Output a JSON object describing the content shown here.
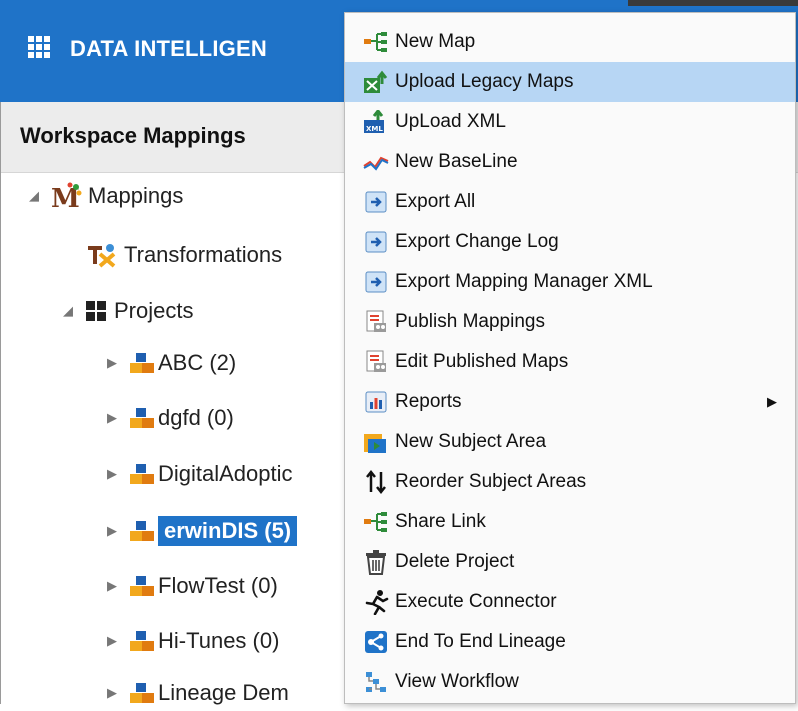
{
  "app": {
    "title": "DATA INTELLIGEN",
    "colors": {
      "header": "#1f73c8",
      "menu_highlight": "#b7d6f4"
    }
  },
  "workspace": {
    "title": "Workspace Mappings"
  },
  "tree": {
    "mappings": {
      "label": "Mappings",
      "icon": "mappings-icon"
    },
    "transformations": {
      "label": "Transformations",
      "icon": "transformations-icon"
    },
    "projects": {
      "label": "Projects",
      "icon": "projects-icon"
    },
    "items": [
      {
        "label": "ABC (2)"
      },
      {
        "label": "dgfd (0)"
      },
      {
        "label": "DigitalAdoptic"
      },
      {
        "label": "erwinDIS (5)",
        "selected": true
      },
      {
        "label": "FlowTest (0)"
      },
      {
        "label": "Hi-Tunes (0)"
      },
      {
        "label": "Lineage Dem"
      }
    ]
  },
  "menu": {
    "items": [
      {
        "label": "New Map",
        "icon": "new-map-icon"
      },
      {
        "label": "Upload Legacy Maps",
        "icon": "upload-legacy-icon",
        "highlighted": true
      },
      {
        "label": "UpLoad XML",
        "icon": "upload-xml-icon"
      },
      {
        "label": "New BaseLine",
        "icon": "baseline-icon"
      },
      {
        "label": "Export All",
        "icon": "export-icon"
      },
      {
        "label": "Export Change Log",
        "icon": "export-icon"
      },
      {
        "label": "Export Mapping Manager XML",
        "icon": "export-icon"
      },
      {
        "label": "Publish Mappings",
        "icon": "publish-icon"
      },
      {
        "label": "Edit Published Maps",
        "icon": "publish-icon"
      },
      {
        "label": "Reports",
        "icon": "reports-icon",
        "submenu": true
      },
      {
        "label": "New Subject Area",
        "icon": "subject-area-icon"
      },
      {
        "label": "Reorder Subject Areas",
        "icon": "reorder-icon"
      },
      {
        "label": "Share Link",
        "icon": "share-link-icon"
      },
      {
        "label": "Delete Project",
        "icon": "trash-icon"
      },
      {
        "label": "Execute Connector",
        "icon": "runner-icon"
      },
      {
        "label": "End To End Lineage",
        "icon": "lineage-icon"
      },
      {
        "label": "View Workflow",
        "icon": "workflow-icon"
      }
    ]
  }
}
